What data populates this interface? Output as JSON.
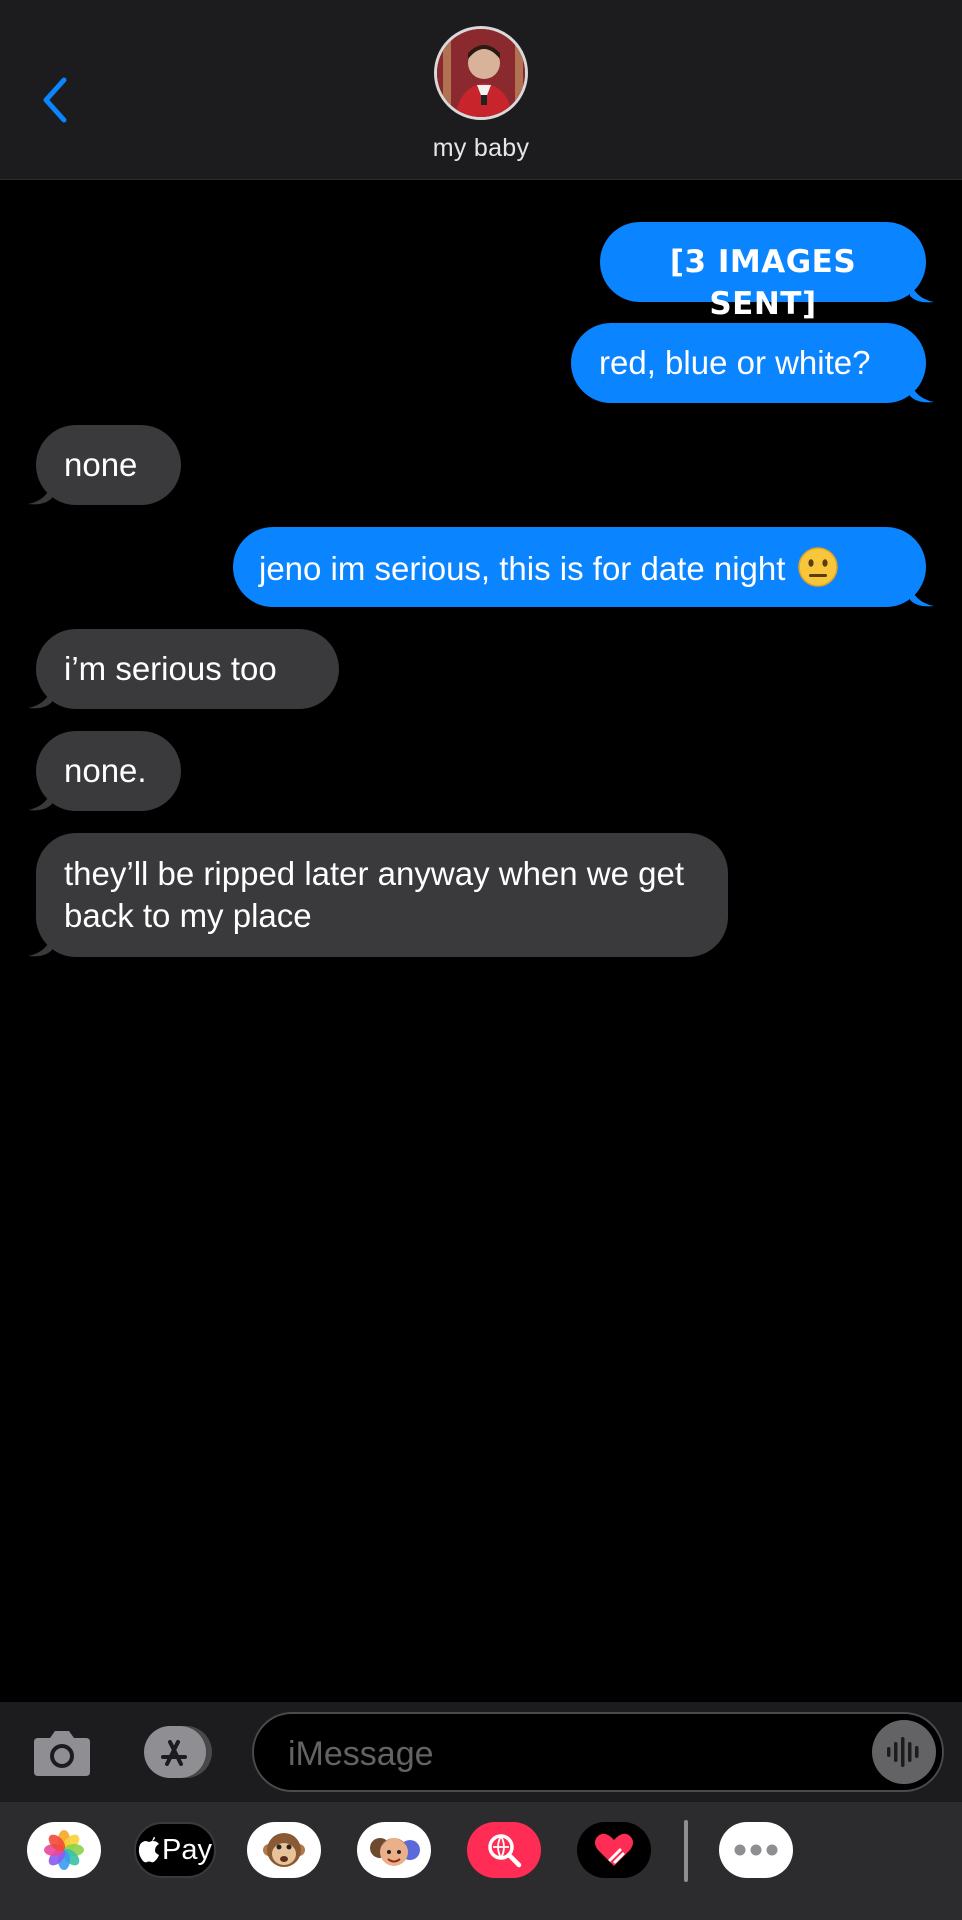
{
  "header": {
    "contact_name": "my baby",
    "accent": "#0a84ff"
  },
  "messages": [
    {
      "from": "me",
      "text": "[3 IMAGES SENT]"
    },
    {
      "from": "me",
      "text": "red, blue or white?"
    },
    {
      "from": "them",
      "text": "none"
    },
    {
      "from": "me",
      "text": "jeno im serious, this is for date night"
    },
    {
      "from": "them",
      "text": "i’m serious too"
    },
    {
      "from": "them",
      "text": "none."
    },
    {
      "from": "them",
      "text": "they’ll be ripped later anyway when we get back to my place"
    }
  ],
  "composer": {
    "placeholder": "iMessage"
  },
  "drawer": {
    "apple_pay_label": "Pay",
    "apps": [
      "photos-icon",
      "apple-pay-icon",
      "animoji-icon",
      "memoji-icon",
      "web-search-icon",
      "digital-touch-icon",
      "more-icon"
    ]
  }
}
